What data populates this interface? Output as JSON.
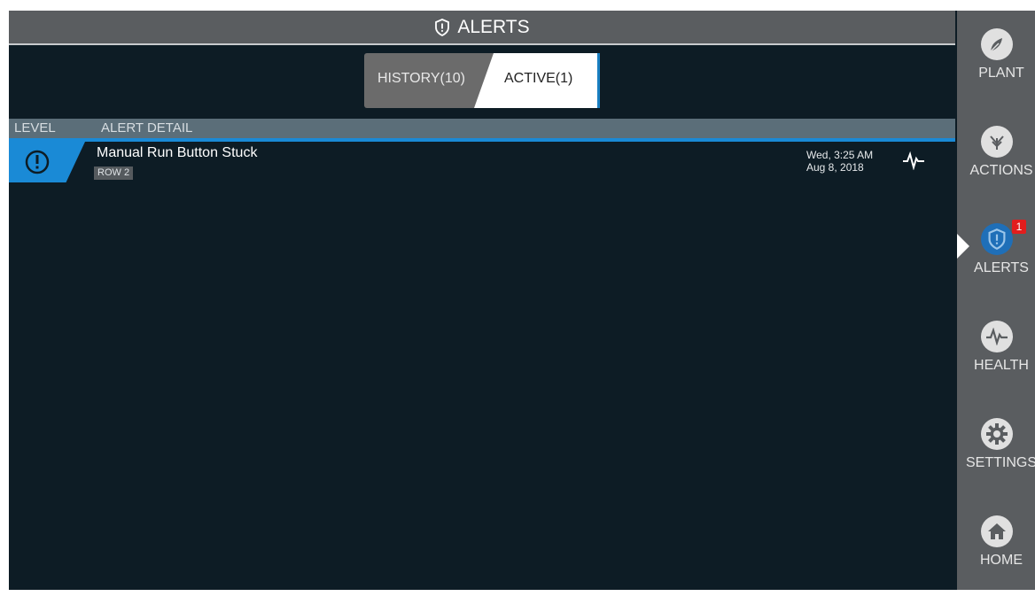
{
  "header": {
    "title": "ALERTS",
    "icon": "shield-alert-icon"
  },
  "tabs": {
    "history_label": "HISTORY(10)",
    "active_label": "ACTIVE(1)",
    "selected": "active"
  },
  "columns": {
    "level": "LEVEL",
    "detail": "ALERT DETAIL"
  },
  "alerts": [
    {
      "title": "Manual Run Button Stuck",
      "tag": "ROW 2",
      "date_line1": "Wed, 3:25 AM",
      "date_line2": "Aug 8, 2018",
      "level_icon": "info-circle-icon",
      "action_icon": "pulse-icon"
    }
  ],
  "sidebar": {
    "items": [
      {
        "label": "PLANT",
        "icon": "plant-icon"
      },
      {
        "label": "ACTIONS",
        "icon": "sprinkler-icon"
      },
      {
        "label": "ALERTS",
        "icon": "shield-alert-icon",
        "badge": "1",
        "active": true
      },
      {
        "label": "HEALTH",
        "icon": "pulse-icon"
      },
      {
        "label": "SETTINGS",
        "icon": "gear-icon"
      },
      {
        "label": "HOME",
        "icon": "home-icon"
      }
    ]
  },
  "colors": {
    "accent": "#1a8ad6",
    "background": "#0d1c25",
    "badge": "#e21d1d",
    "panel": "#5a5d60"
  }
}
